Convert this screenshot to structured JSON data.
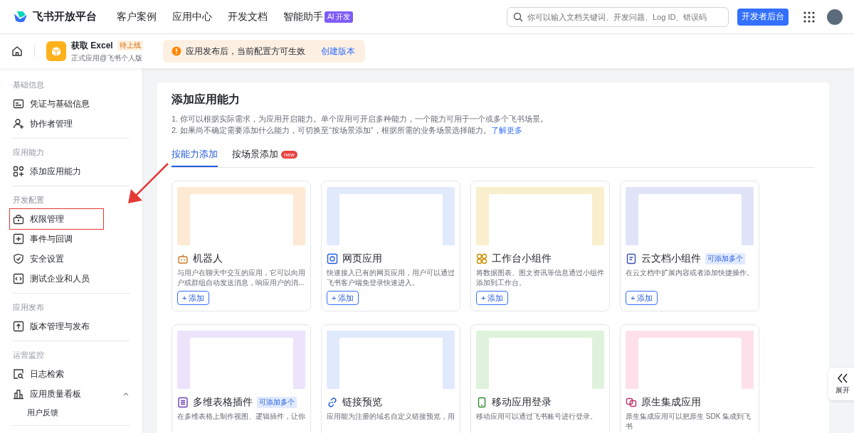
{
  "header": {
    "logo_text": "飞书开放平台",
    "nav": [
      {
        "label": "客户案例"
      },
      {
        "label": "应用中心"
      },
      {
        "label": "开发文档"
      },
      {
        "label": "智能助手",
        "badge": "AI 开发"
      }
    ],
    "search": {
      "placeholder": "你可以输入文档关键词、开发问题、Log ID、错误码"
    },
    "primary_button": "开发者后台"
  },
  "app_bar": {
    "app_name": "获取 Excel",
    "status_badge": "待上线",
    "subtitle": "正式应用@飞书个人版",
    "notice": {
      "text": "应用发布后，当前配置方可生效",
      "link": "创建版本"
    }
  },
  "sidebar": {
    "sections": [
      {
        "title": "基础信息",
        "items": [
          {
            "label": "凭证与基础信息",
            "annotated": false
          },
          {
            "label": "协作者管理",
            "annotated": false
          }
        ]
      },
      {
        "title": "应用能力",
        "items": [
          {
            "label": "添加应用能力",
            "annotated": false
          }
        ]
      },
      {
        "title": "开发配置",
        "items": [
          {
            "label": "权限管理",
            "annotated": true
          },
          {
            "label": "事件与回调",
            "annotated": false
          },
          {
            "label": "安全设置",
            "annotated": false
          },
          {
            "label": "测试企业和人员",
            "annotated": false
          }
        ]
      },
      {
        "title": "应用发布",
        "items": [
          {
            "label": "版本管理与发布",
            "annotated": false
          }
        ]
      },
      {
        "title": "运营监控",
        "items": [
          {
            "label": "日志检索",
            "annotated": false
          },
          {
            "label": "应用质量看板",
            "annotated": false,
            "expanded": true,
            "children": [
              {
                "label": "用户反馈"
              }
            ]
          }
        ]
      }
    ]
  },
  "main": {
    "title": "添加应用能力",
    "notes": [
      {
        "text": "1. 你可以根据实际需求，为应用开启能力。单个应用可开启多种能力，一个能力可用于一个或多个飞书场景。"
      },
      {
        "text": "2. 如果尚不确定需要添加什么能力，可切换至“按场景添加”，根据所需的业务场景选择能力。",
        "link": "了解更多"
      }
    ],
    "tabs": [
      {
        "label": "按能力添加",
        "selected": true
      },
      {
        "label": "按场景添加",
        "selected": false,
        "badge": "new"
      }
    ],
    "cards": [
      {
        "title": "机器人",
        "description": "与用户在聊天中交互的应用，它可以向用户或群组自动发送消息，响应用户的消...",
        "button": "+ 添加",
        "color": "#fde9d4"
      },
      {
        "title": "网页应用",
        "description": "快速接入已有的网页应用，用户可以通过飞书客户端免登录快速进入。",
        "button": "+ 添加",
        "color": "#e1e9fc"
      },
      {
        "title": "工作台小组件",
        "description": "将数据图表、图文资讯等信息通过小组件添加到工作台。",
        "button": "+ 添加",
        "color": "#faefcd"
      },
      {
        "title": "云文档小组件",
        "tag": "可添加多个",
        "description": "在云文档中扩展内容或者添加快捷操作。",
        "button": "+ 添加",
        "color": "#e1e3f8"
      },
      {
        "title": "多维表格插件",
        "tag": "可添加多个",
        "description": "在多维表格上制作视图、逻辑插件，让你",
        "color": "#ece3fb"
      },
      {
        "title": "链接预览",
        "description": "应用能为注册的域名自定义链接预览，用",
        "color": "#e1e9fc"
      },
      {
        "title": "移动应用登录",
        "description": "移动应用可以通过飞书账号进行登录。",
        "color": "#dff3dc"
      },
      {
        "title": "原生集成应用",
        "description": "原生集成应用可以把原生 SDK 集成到飞书",
        "color": "#fde0ea"
      }
    ]
  },
  "expand_button": "展开"
}
